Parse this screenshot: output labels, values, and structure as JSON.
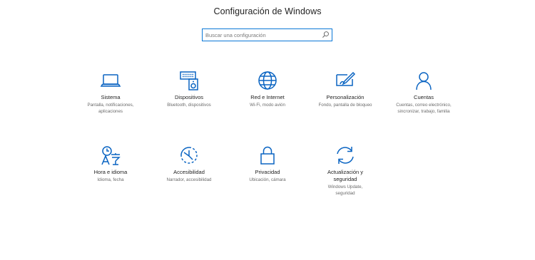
{
  "header": {
    "title": "Configuración de Windows"
  },
  "search": {
    "placeholder": "Buscar una configuración"
  },
  "tiles": [
    {
      "name": "Sistema",
      "desc": "Pantalla, notificaciones, aplicaciones",
      "icon": "laptop-icon"
    },
    {
      "name": "Dispositivos",
      "desc": "Bluetooth, dispositivos",
      "icon": "devices-icon"
    },
    {
      "name": "Red e Internet",
      "desc": "Wi-Fi, modo avión",
      "icon": "globe-icon"
    },
    {
      "name": "Personalización",
      "desc": "Fondo, pantalla de bloqueo",
      "icon": "paint-icon"
    },
    {
      "name": "Cuentas",
      "desc": "Cuentas, correo electrónico, sincronizar, trabajo, familia",
      "icon": "person-icon"
    },
    {
      "name": "Hora e idioma",
      "desc": "Idioma, fecha",
      "icon": "time-language-icon"
    },
    {
      "name": "Accesibilidad",
      "desc": "Narrador, accesibilidad",
      "icon": "accessibility-icon"
    },
    {
      "name": "Privacidad",
      "desc": "Ubicación, cámara",
      "icon": "lock-icon"
    },
    {
      "name": "Actualización y seguridad",
      "desc": "Windows Update, seguridad",
      "icon": "sync-icon"
    }
  ],
  "colors": {
    "accent": "#0a64c2",
    "search_border": "#0a78d7"
  }
}
